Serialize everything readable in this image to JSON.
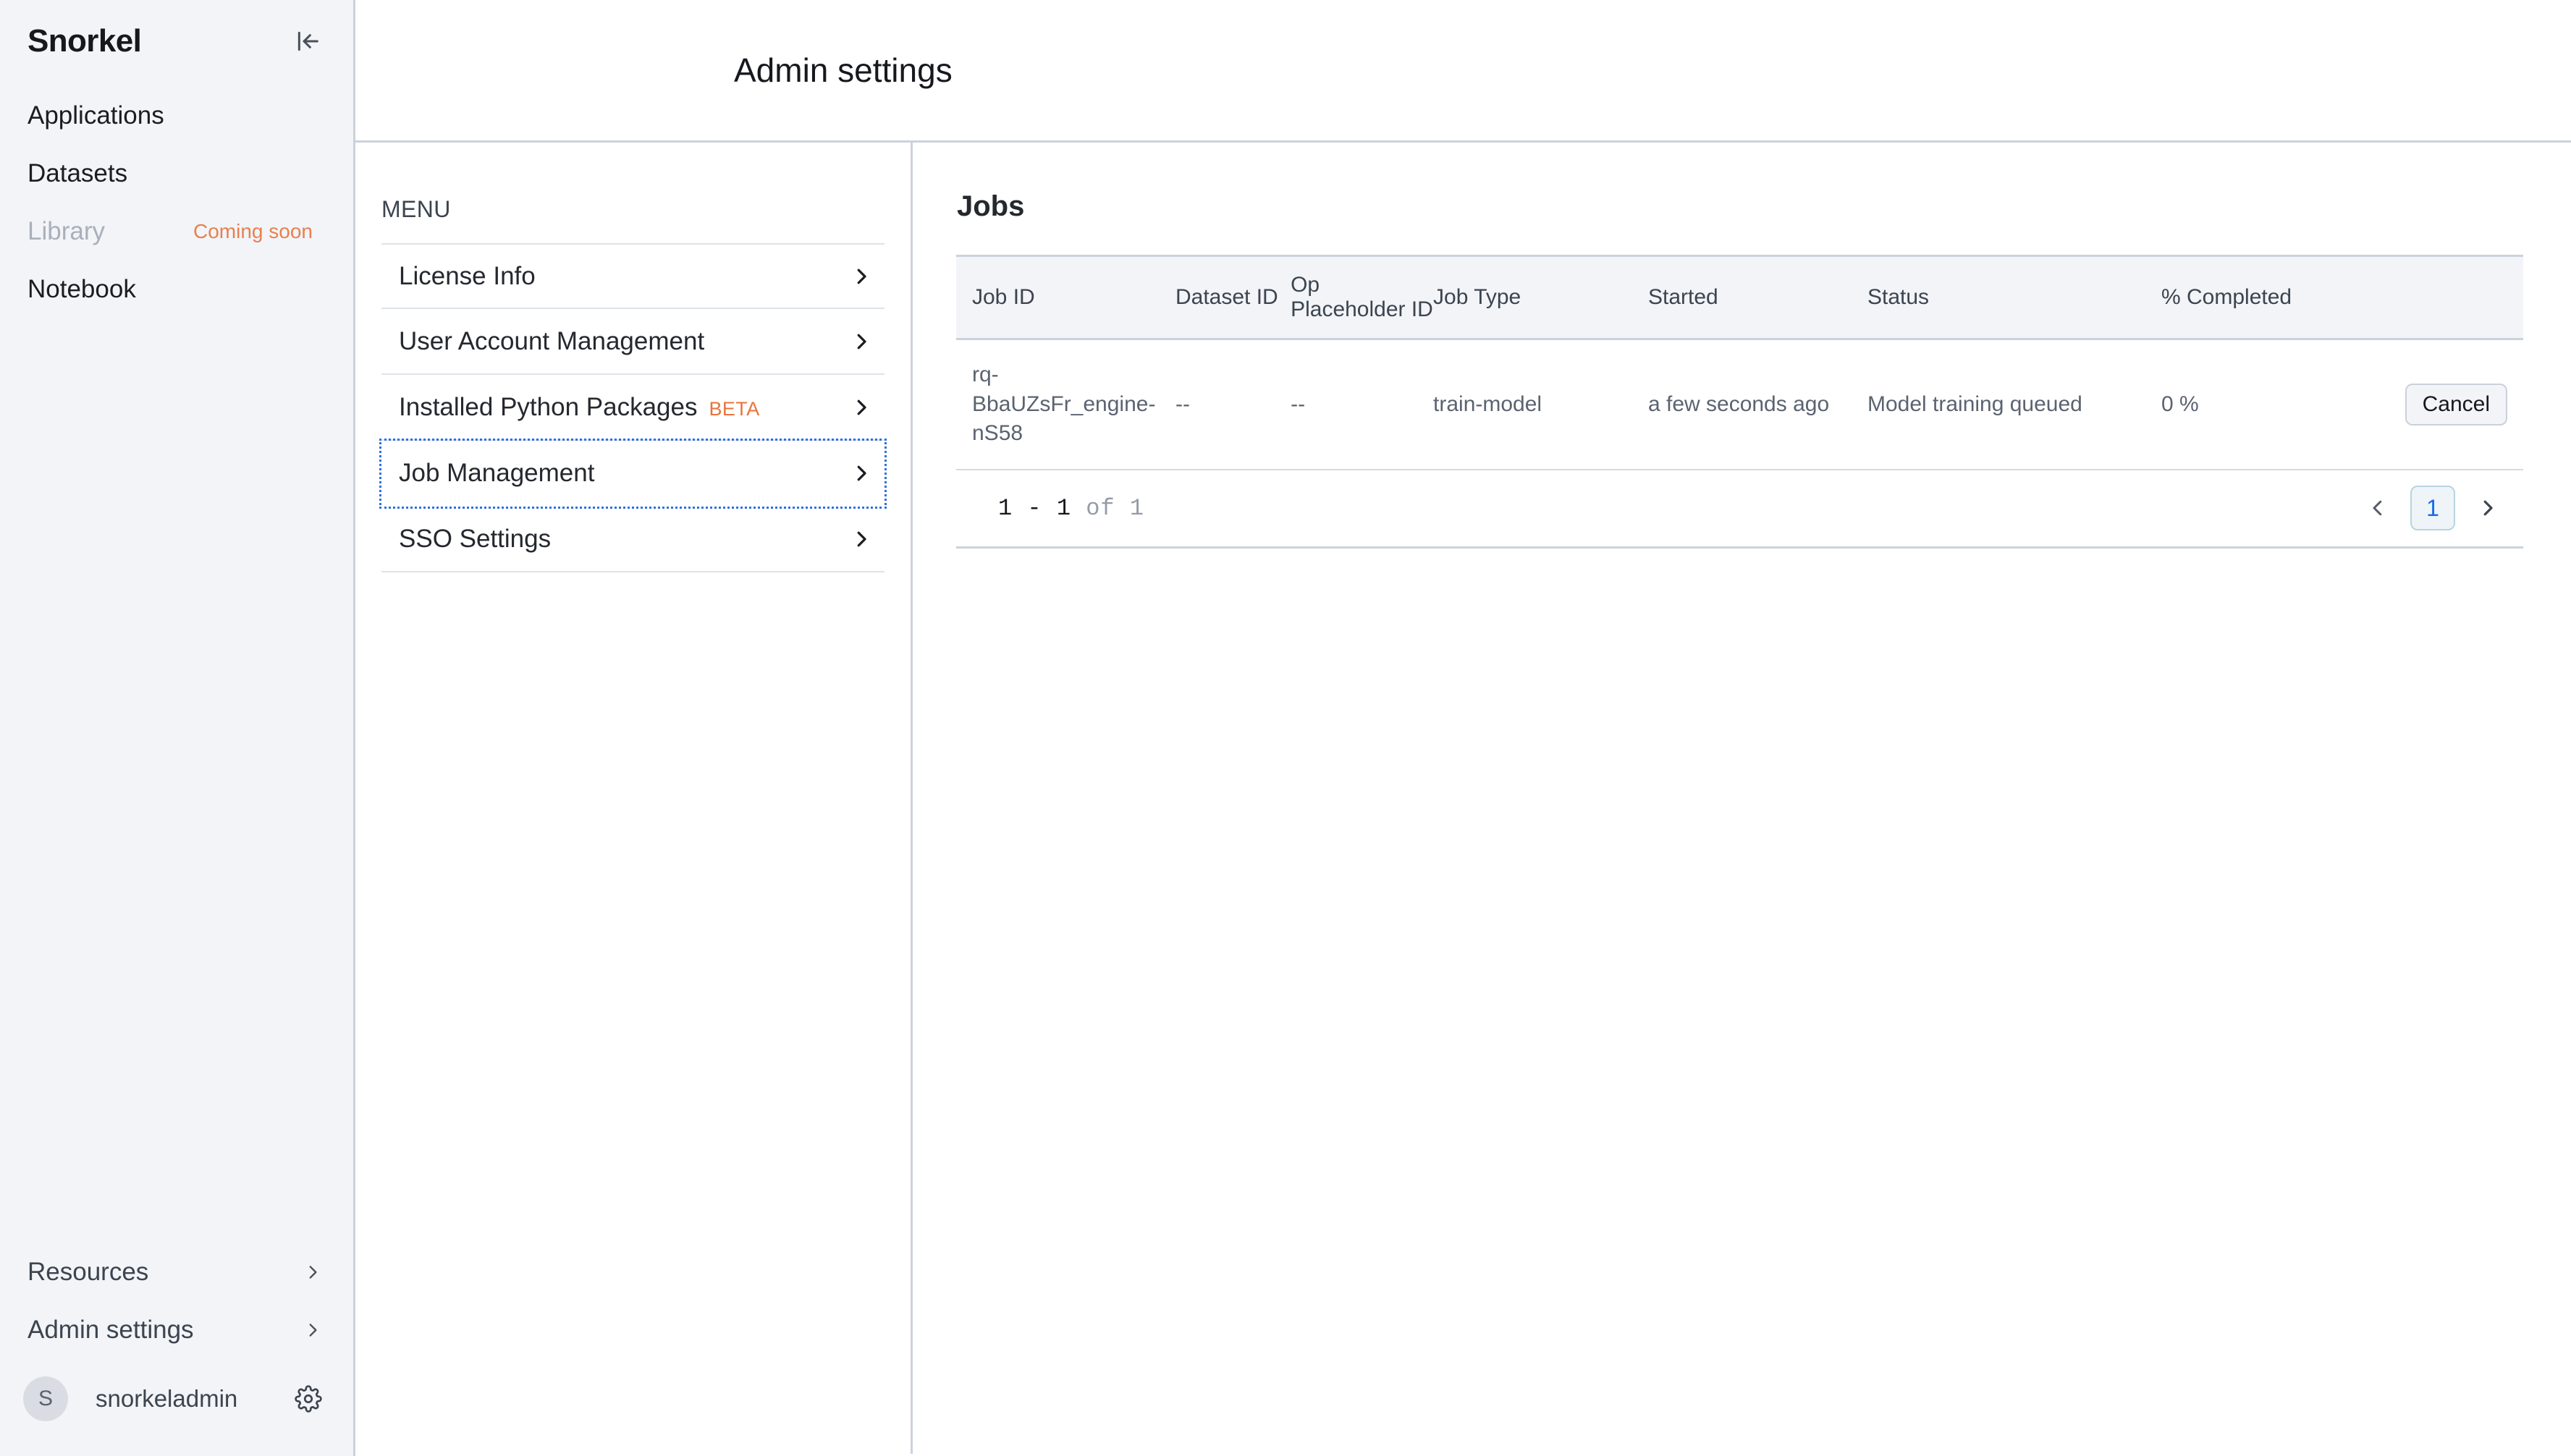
{
  "sidebar": {
    "brand": "Snorkel",
    "collapse_icon": "collapse-panel-icon",
    "nav": [
      {
        "label": "Applications",
        "badge": null,
        "disabled": false
      },
      {
        "label": "Datasets",
        "badge": null,
        "disabled": false
      },
      {
        "label": "Library",
        "badge": "Coming soon",
        "disabled": true
      },
      {
        "label": "Notebook",
        "badge": null,
        "disabled": false
      }
    ],
    "bottom": [
      {
        "label": "Resources"
      },
      {
        "label": "Admin settings"
      }
    ],
    "user": {
      "initial": "S",
      "name": "snorkeladmin",
      "settings_icon": "gear-icon"
    }
  },
  "header": {
    "title": "Admin settings"
  },
  "menu_panel": {
    "heading": "MENU",
    "items": [
      {
        "label": "License Info",
        "badge": null,
        "focused": false
      },
      {
        "label": "User Account Management",
        "badge": null,
        "focused": false
      },
      {
        "label": "Installed Python Packages",
        "badge": "BETA",
        "focused": false
      },
      {
        "label": "Job Management",
        "badge": null,
        "focused": true
      },
      {
        "label": "SSO Settings",
        "badge": null,
        "focused": false
      }
    ]
  },
  "jobs": {
    "title": "Jobs",
    "columns": [
      "Job ID",
      "Dataset ID",
      "Op Placeholder ID",
      "Job Type",
      "Started",
      "Status",
      "% Completed",
      ""
    ],
    "rows": [
      {
        "job_id": "rq-BbaUZsFr_engine-nS58",
        "dataset_id": "--",
        "op_placeholder_id": "--",
        "job_type": "train-model",
        "started": "a few seconds ago",
        "status": "Model training queued",
        "percent_completed": "0 %",
        "action_label": "Cancel"
      }
    ],
    "pagination": {
      "range": "1 - 1",
      "total": "of 1",
      "prev_icon": "chevron-left-icon",
      "next_icon": "chevron-right-icon",
      "current_page": "1"
    }
  },
  "colors": {
    "accent_orange": "#e8743b",
    "coming_soon": "#e8804f",
    "page_active": "#1668f0",
    "focus_outline": "#2f6fe0",
    "sidebar_bg": "#f2f4f7"
  }
}
